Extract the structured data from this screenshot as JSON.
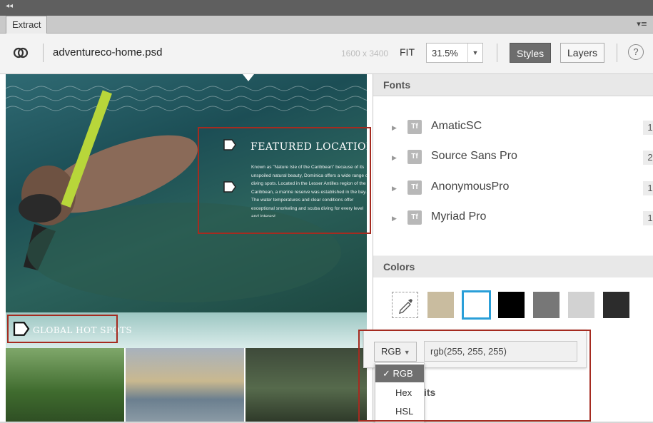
{
  "window": {
    "collapse_glyph": "◂◂"
  },
  "tab": {
    "label": "Extract",
    "menu_glyph": "▾≡"
  },
  "toolbar": {
    "filename": "adventureco-home.psd",
    "dimensions": "1600 x 3400",
    "fit_label": "FIT",
    "zoom_value": "31.5%",
    "styles_label": "Styles",
    "layers_label": "Layers",
    "help_glyph": "?"
  },
  "canvas": {
    "featured_title": "FEATURED LOCATION : DOMINICA",
    "featured_body": "Known as \"Nature Isle of the Caribbean\" because of its unspoiled natural beauty, Dominica offers a wide range of diving spots. Located in the Lesser Antilles region of the Caribbean, a marine reserve was established in the bay. The water temperatures and clear conditions offer exceptional snorkeling and scuba diving for every level and interest.",
    "global_title": "GLOBAL HOT SPOTS"
  },
  "panel": {
    "fonts_header": "Fonts",
    "fonts": [
      {
        "name": "AmaticSC",
        "count": "1"
      },
      {
        "name": "Source Sans Pro",
        "count": "2"
      },
      {
        "name": "AnonymousPro",
        "count": "1"
      },
      {
        "name": "Myriad Pro",
        "count": "1"
      }
    ],
    "colors_header": "Colors",
    "swatches": [
      {
        "color": "#ffffff",
        "kind": "eyedropper"
      },
      {
        "color": "#c9bc9f"
      },
      {
        "color": "#ffffff",
        "selected": true
      },
      {
        "color": "#000000"
      },
      {
        "color": "#777777"
      },
      {
        "color": "#d2d2d2"
      },
      {
        "color": "#2c2c2c"
      }
    ],
    "format_select": "RGB",
    "color_value": "rgb(255, 255, 255)",
    "format_options": [
      "RGB",
      "Hex",
      "HSL"
    ],
    "selected_format": "RGB",
    "obscured_header_tail": "its"
  },
  "accent": {
    "selection_blue": "#2a9fd8",
    "highlight_red": "#a52b20"
  }
}
